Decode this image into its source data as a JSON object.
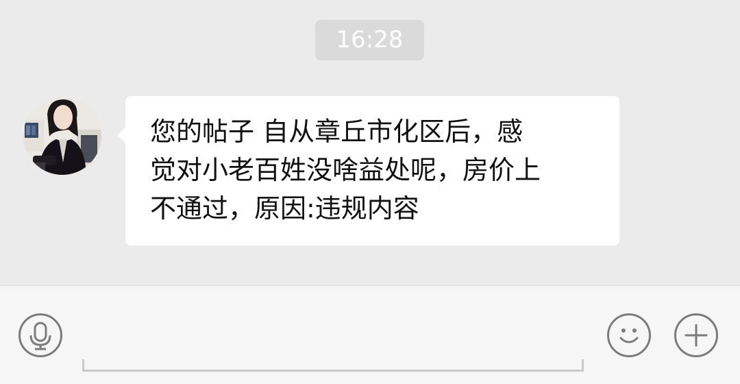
{
  "chat": {
    "timestamp": "16:28",
    "message": {
      "lines": [
        "您的帖子 自从章丘市化区后，感",
        "觉对小老百姓没啥益处呢，房价上",
        "不通过，原因:违规内容"
      ]
    }
  },
  "input_bar": {
    "text_value": "",
    "icons": {
      "voice": "microphone-icon",
      "emoji": "smiley-icon",
      "more": "plus-icon"
    }
  },
  "colors": {
    "chat_background": "#ebebeb",
    "bubble": "#ffffff",
    "timestamp_bg": "#dadada",
    "input_bar_bg": "#f6f6f6",
    "icon_stroke": "#7b7b7b"
  }
}
